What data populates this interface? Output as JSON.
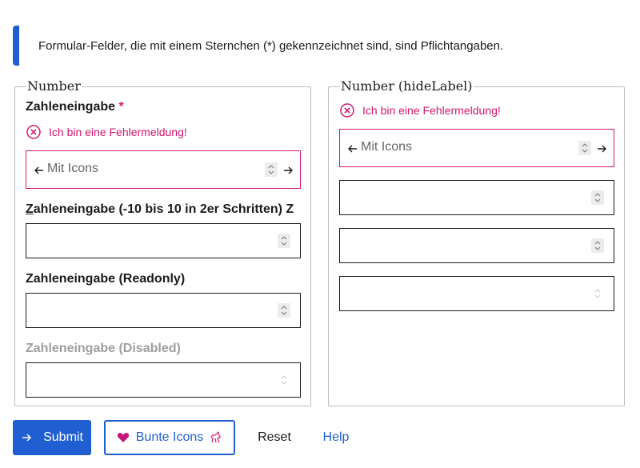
{
  "notice": {
    "text": "Formular-Felder, die mit einem Sternchen (*) gekennzeichnet sind, sind Pflichtangaben."
  },
  "fieldset_left": {
    "legend": "Number",
    "field1": {
      "label": "Zahleneingabe",
      "required_mark": "*",
      "error": "Ich bin eine Fehlermeldung!",
      "placeholder": "Mit Icons"
    },
    "field2": {
      "label_accesskey": "Z",
      "label_rest": "ahleneingabe (-10 bis 10 in 2er Schritten) Z"
    },
    "field3": {
      "label": "Zahleneingabe (Readonly)"
    },
    "field4": {
      "label": "Zahleneingabe (Disabled)"
    }
  },
  "fieldset_right": {
    "legend": "Number (hideLabel)",
    "field1": {
      "error": "Ich bin eine Fehlermeldung!",
      "placeholder": "Mit Icons"
    }
  },
  "buttons": {
    "submit": "Submit",
    "bunte_icons": "Bunte Icons",
    "reset": "Reset",
    "help": "Help"
  },
  "colors": {
    "primary": "#1f5fd1",
    "error": "#d4166e",
    "border": "#1b1b1b",
    "fieldset_border": "#bdbdbd"
  },
  "icons": {
    "error": "circle-x-icon",
    "left": "arrow-left-icon",
    "right": "arrow-right-icon",
    "submit": "arrow-right-icon",
    "heart": "heart-icon",
    "unicorn": "unicorn-icon",
    "spinner": "spinner-icon"
  }
}
